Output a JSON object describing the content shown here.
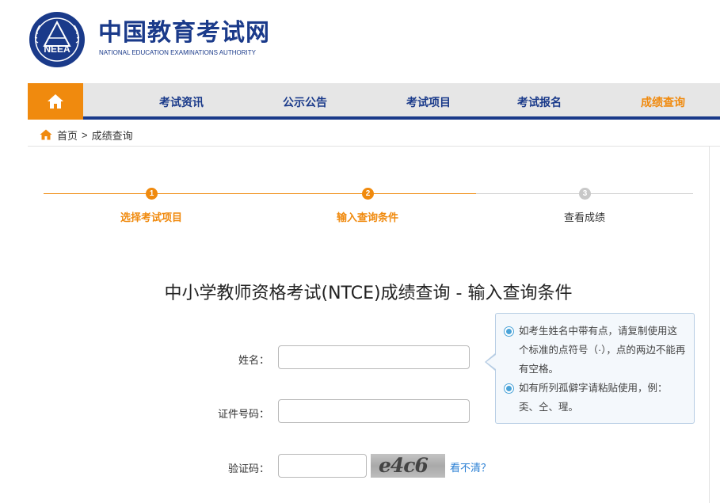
{
  "site": {
    "title_cn": "中国教育考试网",
    "title_en": "NATIONAL EDUCATION EXAMINATIONS AUTHORITY",
    "emblem_text": "NEEA"
  },
  "nav": {
    "items": [
      {
        "label": "考试资讯"
      },
      {
        "label": "公示公告"
      },
      {
        "label": "考试项目"
      },
      {
        "label": "考试报名"
      },
      {
        "label": "成绩查询"
      }
    ],
    "active_color": "#f08a0e",
    "brand_color": "#1a3a8a"
  },
  "breadcrumb": {
    "home": "首页",
    "separator": ">",
    "current": "成绩查询"
  },
  "steps": [
    {
      "number": "1",
      "label": "选择考试项目",
      "state": "done"
    },
    {
      "number": "2",
      "label": "输入查询条件",
      "state": "done"
    },
    {
      "number": "3",
      "label": "查看成绩",
      "state": "todo"
    }
  ],
  "form": {
    "title": "中小学教师资格考试(NTCE)成绩查询 - 输入查询条件",
    "name_label": "姓名：",
    "name_value": "",
    "id_label": "证件号码：",
    "id_value": "",
    "captcha_label": "验证码：",
    "captcha_value": "",
    "captcha_image_text": "e4c6",
    "refresh_link": "看不清？"
  },
  "tips": [
    {
      "text": "如考生姓名中带有点，请复制使用这个标准的点符号（·），点的两边不能再有空格。"
    },
    {
      "text": "如有所列孤僻字请粘贴使用，例：奀、仝、瑆。"
    }
  ]
}
